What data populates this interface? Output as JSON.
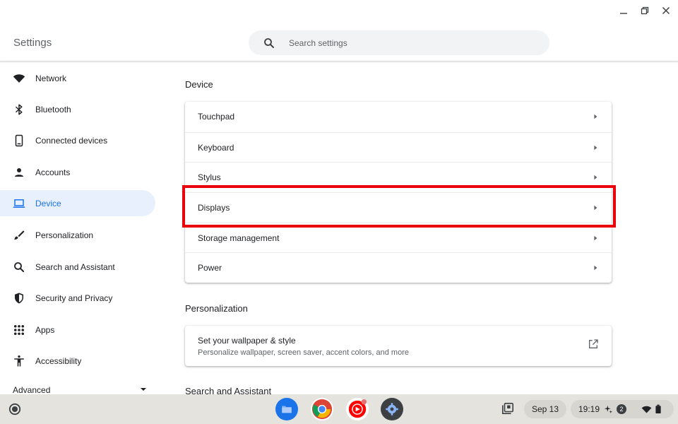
{
  "app": {
    "title": "Settings"
  },
  "window_controls": {
    "minimize": "minimize-icon",
    "maximize": "maximize-icon",
    "close": "close-icon"
  },
  "search": {
    "placeholder": "Search settings",
    "value": ""
  },
  "sidebar": {
    "items": [
      {
        "label": "Network",
        "icon": "wifi-icon",
        "selected": false
      },
      {
        "label": "Bluetooth",
        "icon": "bluetooth-icon",
        "selected": false
      },
      {
        "label": "Connected devices",
        "icon": "phone-icon",
        "selected": false
      },
      {
        "label": "Accounts",
        "icon": "person-icon",
        "selected": false
      },
      {
        "label": "Device",
        "icon": "laptop-icon",
        "selected": true
      },
      {
        "label": "Personalization",
        "icon": "brush-icon",
        "selected": false
      },
      {
        "label": "Search and Assistant",
        "icon": "search-icon",
        "selected": false
      },
      {
        "label": "Security and Privacy",
        "icon": "shield-icon",
        "selected": false
      },
      {
        "label": "Apps",
        "icon": "apps-grid-icon",
        "selected": false
      },
      {
        "label": "Accessibility",
        "icon": "accessibility-icon",
        "selected": false
      }
    ],
    "advanced_label": "Advanced"
  },
  "main": {
    "device_section": {
      "title": "Device",
      "rows": [
        "Touchpad",
        "Keyboard",
        "Stylus",
        "Displays",
        "Storage management",
        "Power"
      ],
      "highlighted_row": "Displays"
    },
    "personalization_section": {
      "title": "Personalization",
      "wallpaper_title": "Set your wallpaper & style",
      "wallpaper_subtitle": "Personalize wallpaper, screen saver, accent colors, and more"
    },
    "search_section": {
      "title": "Search and Assistant"
    }
  },
  "shelf": {
    "apps": [
      "files-icon",
      "chrome-icon",
      "youtube-music-icon",
      "settings-icon"
    ],
    "date": "Sep 13",
    "time": "19:19",
    "notification_count": "2"
  },
  "colors": {
    "accent": "#1a73e8",
    "selected_bg": "#e8f0fe",
    "highlight": "#e8000b",
    "shelf": "#e4e3de"
  }
}
